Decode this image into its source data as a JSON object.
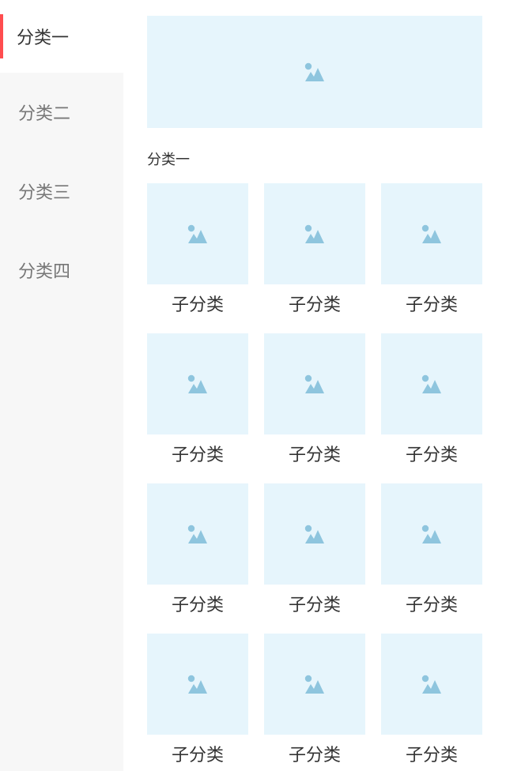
{
  "sidebar": {
    "items": [
      {
        "label": "分类一",
        "active": true
      },
      {
        "label": "分类二",
        "active": false
      },
      {
        "label": "分类三",
        "active": false
      },
      {
        "label": "分类四",
        "active": false
      }
    ]
  },
  "main": {
    "banner_icon": "image-placeholder-icon",
    "section_title": "分类一",
    "subcategories": [
      {
        "label": "子分类",
        "icon": "image-placeholder-icon"
      },
      {
        "label": "子分类",
        "icon": "image-placeholder-icon"
      },
      {
        "label": "子分类",
        "icon": "image-placeholder-icon"
      },
      {
        "label": "子分类",
        "icon": "image-placeholder-icon"
      },
      {
        "label": "子分类",
        "icon": "image-placeholder-icon"
      },
      {
        "label": "子分类",
        "icon": "image-placeholder-icon"
      },
      {
        "label": "子分类",
        "icon": "image-placeholder-icon"
      },
      {
        "label": "子分类",
        "icon": "image-placeholder-icon"
      },
      {
        "label": "子分类",
        "icon": "image-placeholder-icon"
      },
      {
        "label": "子分类",
        "icon": "image-placeholder-icon"
      },
      {
        "label": "子分类",
        "icon": "image-placeholder-icon"
      },
      {
        "label": "子分类",
        "icon": "image-placeholder-icon"
      }
    ]
  },
  "colors": {
    "accent": "#ff4d4f",
    "placeholder_bg": "#e6f5fc",
    "placeholder_icon": "#8ec5de",
    "sidebar_bg": "#f7f7f7"
  }
}
